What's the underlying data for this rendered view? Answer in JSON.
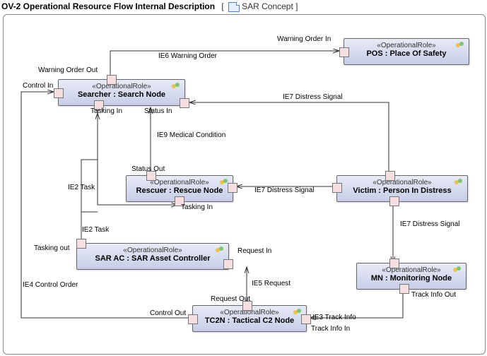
{
  "header": {
    "title": "OV-2 Operational Resource Flow Internal Description",
    "reference": "SAR Concept"
  },
  "nodes": {
    "pos": {
      "stereo": "«OperationalRole»",
      "name": "POS : Place Of Safety"
    },
    "searcher": {
      "stereo": "«OperationalRole»",
      "name": "Searcher : Search Node"
    },
    "rescuer": {
      "stereo": "«OperationalRole»",
      "name": "Rescuer : Rescue Node"
    },
    "victim": {
      "stereo": "«OperationalRole»",
      "name": "Victim : Person In Distress"
    },
    "sarac": {
      "stereo": "«OperationalRole»",
      "name": "SAR AC : SAR Asset Controller"
    },
    "mn": {
      "stereo": "«OperationalRole»",
      "name": "MN : Monitoring Node"
    },
    "tc2n": {
      "stereo": "«OperationalRole»",
      "name": "TC2N : Tactical C2 Node"
    }
  },
  "ports": {
    "warning_order_out": "Warning Order Out",
    "warning_order_in": "Warning Order In",
    "control_in": "Control In",
    "tasking_in_searcher": "Tasking In",
    "status_in": "Status In",
    "status_out": "Status Out",
    "tasking_in_rescuer": "Tasking In",
    "tasking_out": "Tasking out",
    "request_in": "Request In",
    "request_out": "Request Out",
    "control_out": "Control Out",
    "track_info_out": "Track Info Out",
    "track_info_in": "Track Info In"
  },
  "flows": {
    "ie6": "IE6 Warning Order",
    "ie7a": "IE7 Distress Signal",
    "ie7b": "IE7 Distress Signal",
    "ie7c": "IE7 Distress Signal",
    "ie9": "IE9 Medical Condition",
    "ie2a": "IE2 Task",
    "ie2b": "IE2 Task",
    "ie5": "IE5 Request",
    "ie3": "IE3 Track Info",
    "ie4": "IE4 Control Order"
  },
  "chart_data": {
    "type": "table",
    "title": "OV-2 Operational Resource Flow Internal Description — SAR Concept",
    "nodes": [
      {
        "id": "POS",
        "role": "OperationalRole",
        "label": "POS : Place Of Safety"
      },
      {
        "id": "Searcher",
        "role": "OperationalRole",
        "label": "Searcher : Search Node"
      },
      {
        "id": "Rescuer",
        "role": "OperationalRole",
        "label": "Rescuer : Rescue Node"
      },
      {
        "id": "Victim",
        "role": "OperationalRole",
        "label": "Victim : Person In Distress"
      },
      {
        "id": "SAR AC",
        "role": "OperationalRole",
        "label": "SAR AC : SAR Asset Controller"
      },
      {
        "id": "MN",
        "role": "OperationalRole",
        "label": "MN : Monitoring Node"
      },
      {
        "id": "TC2N",
        "role": "OperationalRole",
        "label": "TC2N : Tactical C2 Node"
      }
    ],
    "edges": [
      {
        "id": "IE6",
        "label": "Warning Order",
        "from": "Searcher",
        "from_port": "Warning Order Out",
        "to": "POS",
        "to_port": "Warning Order In"
      },
      {
        "id": "IE7",
        "label": "Distress Signal",
        "from": "Victim",
        "to": "Searcher",
        "to_port": "Status In"
      },
      {
        "id": "IE7",
        "label": "Distress Signal",
        "from": "Victim",
        "to": "Rescuer"
      },
      {
        "id": "IE7",
        "label": "Distress Signal",
        "from": "Victim",
        "to": "MN"
      },
      {
        "id": "IE9",
        "label": "Medical Condition",
        "from": "Rescuer",
        "from_port": "Status Out",
        "to": "Searcher",
        "to_port": "Status In"
      },
      {
        "id": "IE2",
        "label": "Task",
        "from": "Searcher",
        "from_port": "Tasking In",
        "to": "Rescuer",
        "to_port": "Tasking In"
      },
      {
        "id": "IE2",
        "label": "Task",
        "from": "SAR AC",
        "from_port": "Tasking out",
        "to": "Searcher",
        "to_port": "Tasking In"
      },
      {
        "id": "IE5",
        "label": "Request",
        "from": "TC2N",
        "from_port": "Request Out",
        "to": "SAR AC",
        "to_port": "Request In"
      },
      {
        "id": "IE3",
        "label": "Track Info",
        "from": "MN",
        "from_port": "Track Info Out",
        "to": "TC2N",
        "to_port": "Track Info In"
      },
      {
        "id": "IE4",
        "label": "Control Order",
        "from": "TC2N",
        "from_port": "Control Out",
        "to": "Searcher",
        "to_port": "Control In"
      }
    ]
  }
}
